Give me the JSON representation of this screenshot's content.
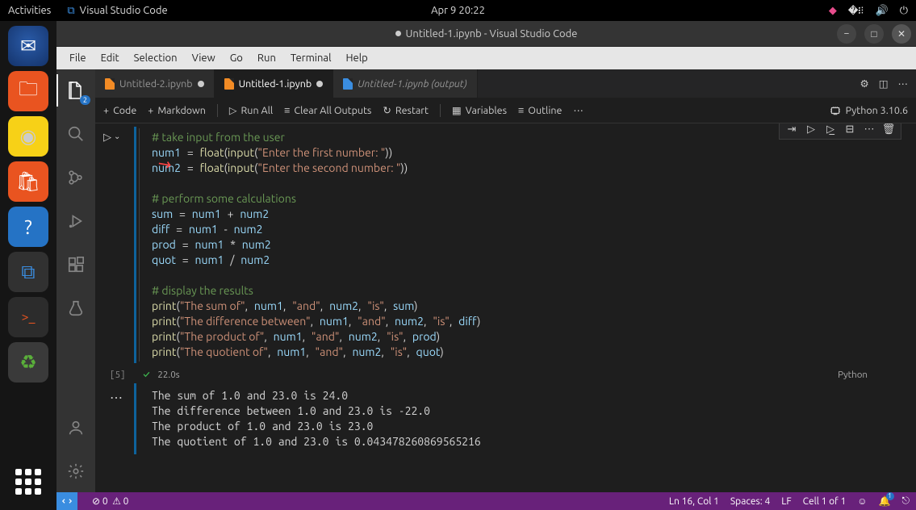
{
  "gnome": {
    "activities": "Activities",
    "app": "Visual Studio Code",
    "datetime": "Apr 9  20:22"
  },
  "titlebar": "Untitled-1.ipynb - Visual Studio Code",
  "menu": [
    "File",
    "Edit",
    "Selection",
    "View",
    "Go",
    "Run",
    "Terminal",
    "Help"
  ],
  "tabs": [
    {
      "label": "Untitled-2.ipynb",
      "dirty": true
    },
    {
      "label": "Untitled-1.ipynb",
      "dirty": true,
      "active": true
    },
    {
      "label": "Untitled-1.ipynb (output)",
      "italic": true
    }
  ],
  "nbToolbar": {
    "code": "Code",
    "markdown": "Markdown",
    "runAll": "Run All",
    "clear": "Clear All Outputs",
    "restart": "Restart",
    "variables": "Variables",
    "outline": "Outline",
    "kernel": "Python 3.10.6"
  },
  "activityBadge": "2",
  "code": {
    "l1": "# take input from the user",
    "l2a": "num1",
    "l2b": "float",
    "l2c": "input",
    "l2d": "\"Enter the first number: \"",
    "l3a": "num2",
    "l3b": "float",
    "l3c": "input",
    "l3d": "\"Enter the second number: \"",
    "l5": "# perform some calculations",
    "l6a": "sum",
    "l6b": "num1",
    "l6c": "num2",
    "l7a": "diff",
    "l7b": "num1",
    "l7c": "num2",
    "l8a": "prod",
    "l8b": "num1",
    "l8c": "num2",
    "l9a": "quot",
    "l9b": "num1",
    "l9c": "num2",
    "l11": "# display the results",
    "l12a": "print",
    "l12b": "\"The sum of\"",
    "l12c": "num1",
    "l12d": "\"and\"",
    "l12e": "num2",
    "l12f": "\"is\"",
    "l12g": "sum",
    "l13a": "print",
    "l13b": "\"The difference between\"",
    "l13c": "num1",
    "l13d": "\"and\"",
    "l13e": "num2",
    "l13f": "\"is\"",
    "l13g": "diff",
    "l14a": "print",
    "l14b": "\"The product of\"",
    "l14c": "num1",
    "l14d": "\"and\"",
    "l14e": "num2",
    "l14f": "\"is\"",
    "l14g": "prod",
    "l15a": "print",
    "l15b": "\"The quotient of\"",
    "l15c": "num1",
    "l15d": "\"and\"",
    "l15e": "num2",
    "l15f": "\"is\"",
    "l15g": "quot"
  },
  "exec": {
    "num": "[5]",
    "time": "22.0s",
    "lang": "Python"
  },
  "output": "The sum of 1.0 and 23.0 is 24.0\nThe difference between 1.0 and 23.0 is -22.0\nThe product of 1.0 and 23.0 is 23.0\nThe quotient of 1.0 and 23.0 is 0.043478260869565216",
  "status": {
    "errors": "0",
    "warnings": "0",
    "lncol": "Ln 16, Col 1",
    "spaces": "Spaces: 4",
    "eol": "LF",
    "cell": "Cell 1 of 1",
    "bell": "1"
  }
}
